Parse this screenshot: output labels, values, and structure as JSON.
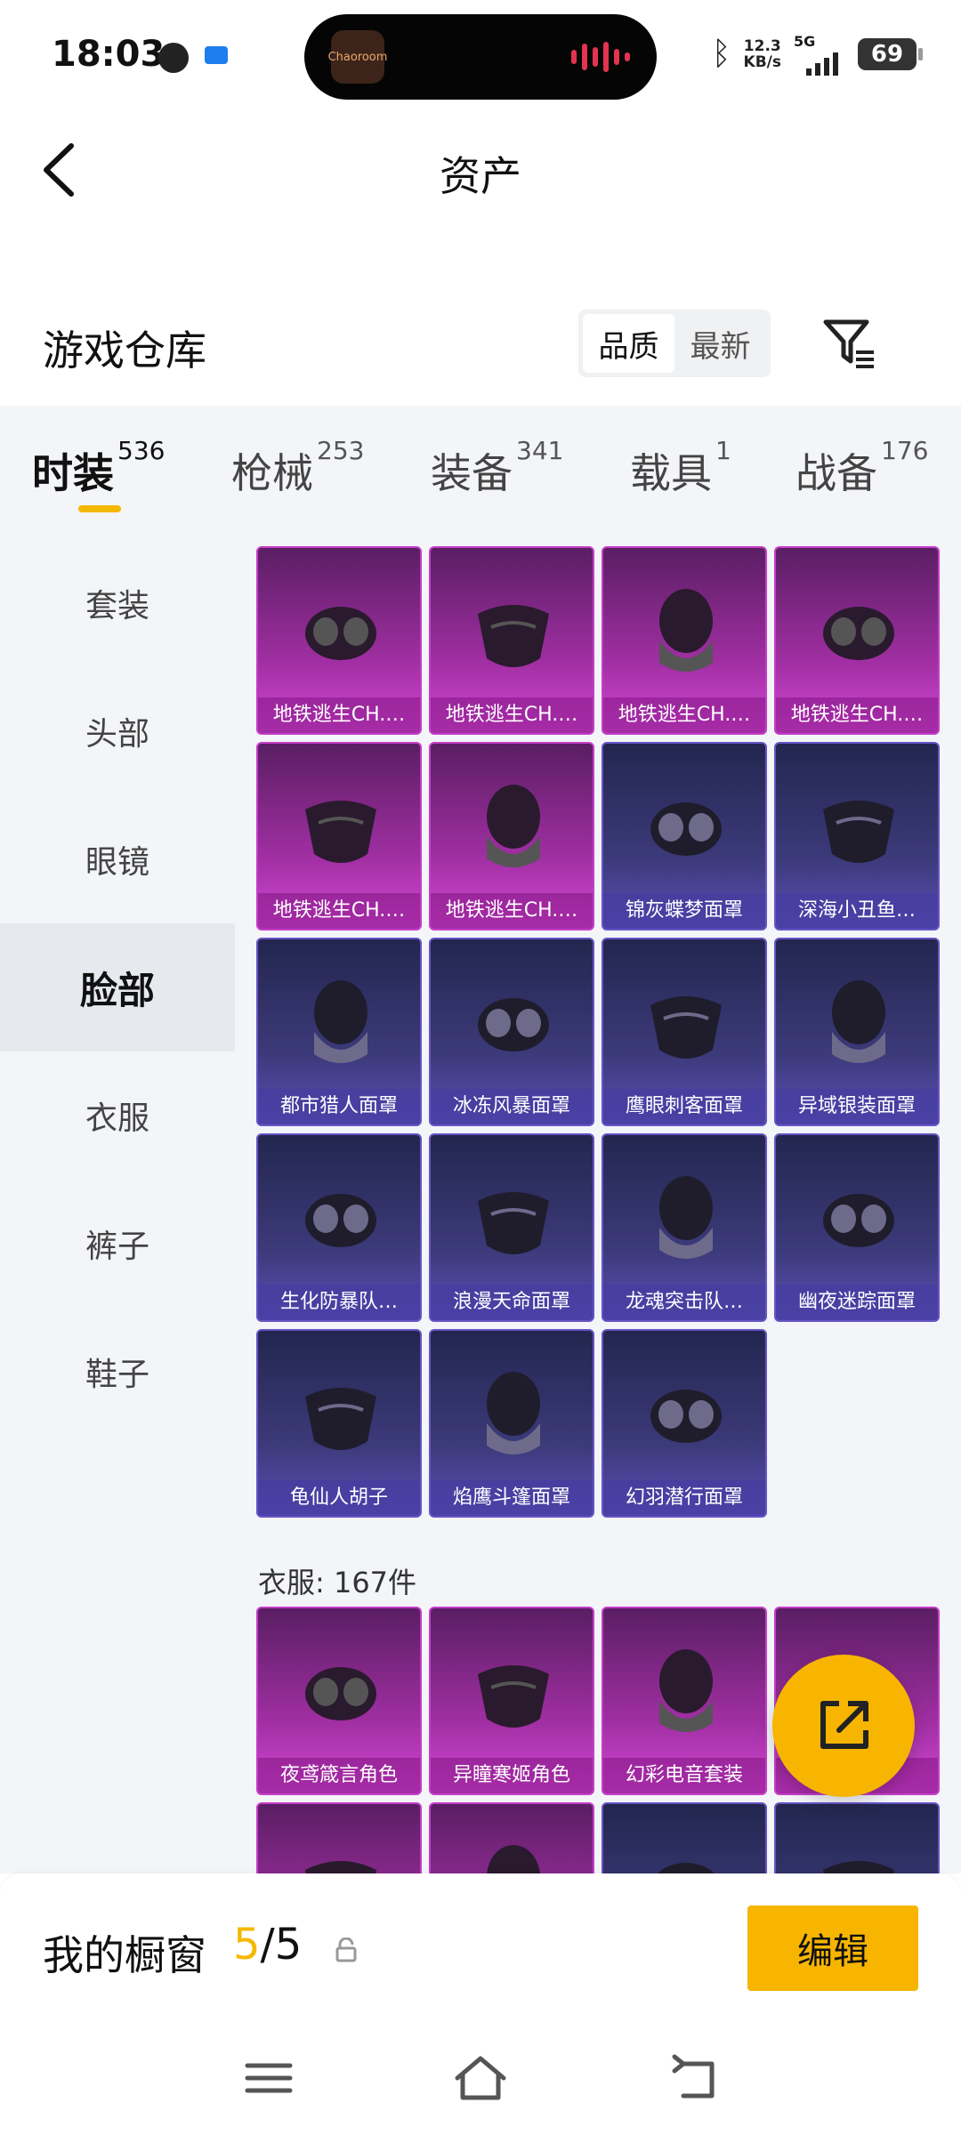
{
  "status_bar": {
    "time": "18:03",
    "net_speed_value": "12.3",
    "net_speed_unit": "KB/s",
    "network": "5G",
    "battery": "69",
    "island_app_text": "Chaoroom"
  },
  "header": {
    "title": "资产",
    "back_icon": "chevron-left-icon"
  },
  "warehouse": {
    "title": "游戏仓库",
    "sort_options": [
      "品质",
      "最新"
    ],
    "sort_selected": "品质"
  },
  "tabs": [
    {
      "label": "时装",
      "count": "536",
      "active": true
    },
    {
      "label": "枪械",
      "count": "253",
      "active": false
    },
    {
      "label": "装备",
      "count": "341",
      "active": false
    },
    {
      "label": "载具",
      "count": "1",
      "active": false
    },
    {
      "label": "战备",
      "count": "176",
      "active": false
    }
  ],
  "side_nav": [
    {
      "label": "套装",
      "active": false
    },
    {
      "label": "头部",
      "active": false
    },
    {
      "label": "眼镜",
      "active": false
    },
    {
      "label": "脸部",
      "active": true
    },
    {
      "label": "衣服",
      "active": false
    },
    {
      "label": "裤子",
      "active": false
    },
    {
      "label": "鞋子",
      "active": false
    }
  ],
  "face_items": [
    {
      "name": "地铁逃生CH.…",
      "rarity": "pink"
    },
    {
      "name": "地铁逃生CH.…",
      "rarity": "pink"
    },
    {
      "name": "地铁逃生CH.…",
      "rarity": "pink"
    },
    {
      "name": "地铁逃生CH.…",
      "rarity": "pink"
    },
    {
      "name": "地铁逃生CH.…",
      "rarity": "pink"
    },
    {
      "name": "地铁逃生CH.…",
      "rarity": "pink"
    },
    {
      "name": "锦灰蝶梦面罩",
      "rarity": "purple"
    },
    {
      "name": "深海小丑鱼…",
      "rarity": "purple"
    },
    {
      "name": "都市猎人面罩",
      "rarity": "purple"
    },
    {
      "name": "冰冻风暴面罩",
      "rarity": "purple"
    },
    {
      "name": "鹰眼刺客面罩",
      "rarity": "purple"
    },
    {
      "name": "异域银装面罩",
      "rarity": "purple"
    },
    {
      "name": "生化防暴队…",
      "rarity": "purple"
    },
    {
      "name": "浪漫天命面罩",
      "rarity": "purple"
    },
    {
      "name": "龙魂突击队…",
      "rarity": "purple"
    },
    {
      "name": "幽夜迷踪面罩",
      "rarity": "purple"
    },
    {
      "name": "龟仙人胡子",
      "rarity": "purple"
    },
    {
      "name": "焰鹰斗篷面罩",
      "rarity": "purple"
    },
    {
      "name": "幻羽潜行面罩",
      "rarity": "purple"
    }
  ],
  "clothes_section": {
    "label": "衣服: 167件",
    "items": [
      {
        "name": "夜鸢箴言角色",
        "rarity": "pink"
      },
      {
        "name": "异瞳寒姬角色",
        "rarity": "pink"
      },
      {
        "name": "幻彩电音套装",
        "rarity": "pink"
      },
      {
        "name": "色",
        "rarity": "pink"
      },
      {
        "name": "",
        "rarity": "pink"
      },
      {
        "name": "",
        "rarity": "pink"
      },
      {
        "name": "",
        "rarity": "purple"
      },
      {
        "name": "",
        "rarity": "purple"
      }
    ]
  },
  "showcase": {
    "label": "我的橱窗",
    "current": "5",
    "separator": "/",
    "total": "5",
    "edit_label": "编辑"
  },
  "colors": {
    "accent": "#f7b500",
    "pink_card": "#a12fa3",
    "purple_card": "#3c3a7a",
    "panel_bg": "#f3f5f8"
  }
}
